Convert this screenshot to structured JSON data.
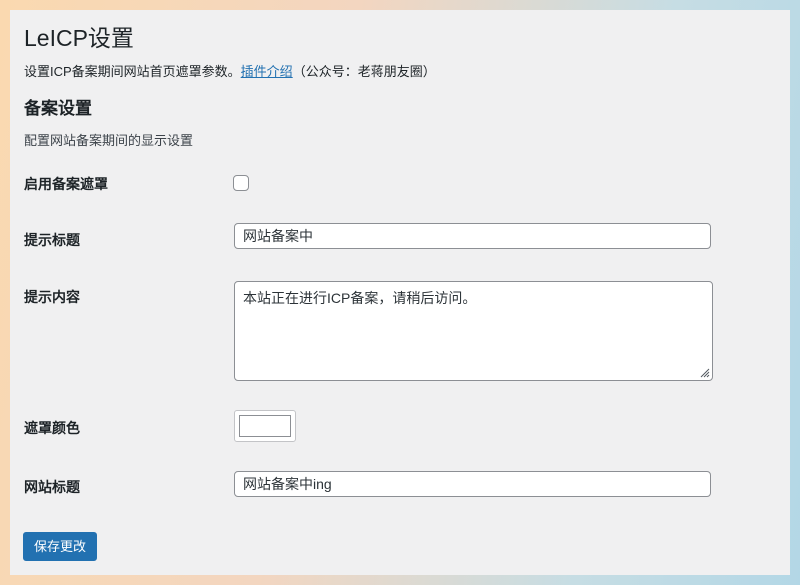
{
  "page": {
    "title": "LeICP设置",
    "intro_text": "设置ICP备案期间网站首页遮罩参数。",
    "intro_link": "插件介绍",
    "intro_suffix": "（公众号：老蒋朋友圈）"
  },
  "section": {
    "heading": "备案设置",
    "description": "配置网站备案期间的显示设置"
  },
  "form": {
    "enable_mask": {
      "label": "启用备案遮罩",
      "checked": false
    },
    "prompt_title": {
      "label": "提示标题",
      "value": "网站备案中"
    },
    "prompt_content": {
      "label": "提示内容",
      "value": "本站正在进行ICP备案，请稍后访问。"
    },
    "mask_color": {
      "label": "遮罩颜色",
      "value": "#ffffff"
    },
    "site_title": {
      "label": "网站标题",
      "value": "网站备案中ing"
    }
  },
  "buttons": {
    "save": "保存更改"
  }
}
